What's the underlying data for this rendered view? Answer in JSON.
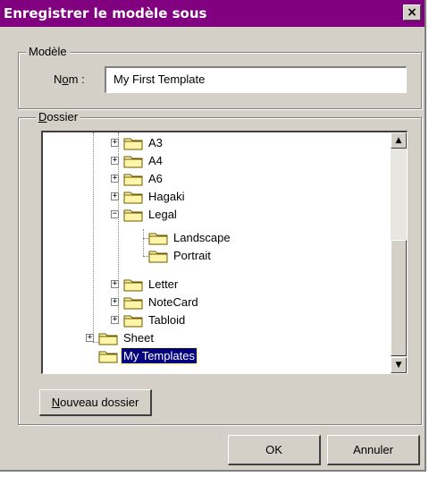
{
  "window": {
    "title": "Enregistrer le modèle sous",
    "close_glyph": "×"
  },
  "model_group": {
    "legend": "Modèle",
    "name_label_pre": "N",
    "name_label_accel": "o",
    "name_label_post": "m :",
    "name_value": "My First Template"
  },
  "folder_group": {
    "legend_accel": "D",
    "legend_rest": "ossier",
    "tree": [
      {
        "label": "A3",
        "expander": "+"
      },
      {
        "label": "A4",
        "expander": "+"
      },
      {
        "label": "A6",
        "expander": "+"
      },
      {
        "label": "Hagaki",
        "expander": "+"
      },
      {
        "label": "Legal",
        "expander": "−"
      },
      {
        "label": "Landscape"
      },
      {
        "label": "Portrait"
      },
      {
        "label": "Letter",
        "expander": "+"
      },
      {
        "label": "NoteCard",
        "expander": "+"
      },
      {
        "label": "Tabloid",
        "expander": "+"
      },
      {
        "label": "Sheet",
        "expander": "+"
      },
      {
        "label": "My Templates",
        "selected": true
      }
    ],
    "scroll_up_glyph": "▲",
    "scroll_down_glyph": "▼"
  },
  "buttons": {
    "new_folder_accel": "N",
    "new_folder_rest": "ouveau dossier",
    "ok": "OK",
    "cancel": "Annuler"
  },
  "colors": {
    "titlebar": "#800080",
    "face": "#d4d0c8",
    "selection": "#000080"
  }
}
